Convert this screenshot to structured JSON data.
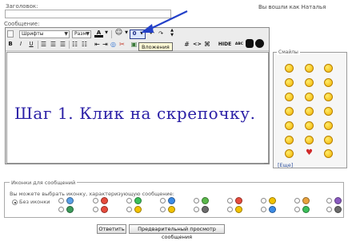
{
  "header": {
    "title_label": "Заголовок:",
    "logged_in": "Вы вошли как Наталья",
    "message_label": "Сообщение:"
  },
  "toolbar": {
    "font_select": "Шрифты",
    "size_select": "Разм",
    "color_label": "A",
    "smile_label": "☺",
    "attach_label": "0",
    "undo_label": "↶",
    "redo_label": "↷",
    "bold_label": "B",
    "italic_label": "I",
    "underline_label": "U",
    "hash_label": "#",
    "code_label": "<>",
    "php_label": "⌘",
    "hide_label": "HIDE",
    "abc_label": "ABC",
    "tooltip": "Вложения"
  },
  "editor": {
    "content": "Шаг 1. Клик на скрепочку."
  },
  "smiles": {
    "title": "Смайлы",
    "more": "[Еще]"
  },
  "post_icons": {
    "legend": "Иконки для сообщений",
    "hint": "Вы можете выбрать иконку, характеризующую сообщение:",
    "no_icon": "Без иконки",
    "colors": [
      "#5aa0e6",
      "#e64b3c",
      "#3cbf5a",
      "#3c8be6",
      "#5ab84a",
      "#e64b3c",
      "#f2c200",
      "#e8a23c",
      "#8a5ac0",
      "#3c9a5a",
      "#e64b3c",
      "#f2c200",
      "#f2c200",
      "#6b6b6b",
      "#f2c200",
      "#3c8be6",
      "#3cbf5a",
      "#6b6b6b"
    ]
  },
  "buttons": {
    "reply": "Ответить",
    "preview": "Предварительный просмотр сообщения"
  },
  "accent": "#2340c8"
}
